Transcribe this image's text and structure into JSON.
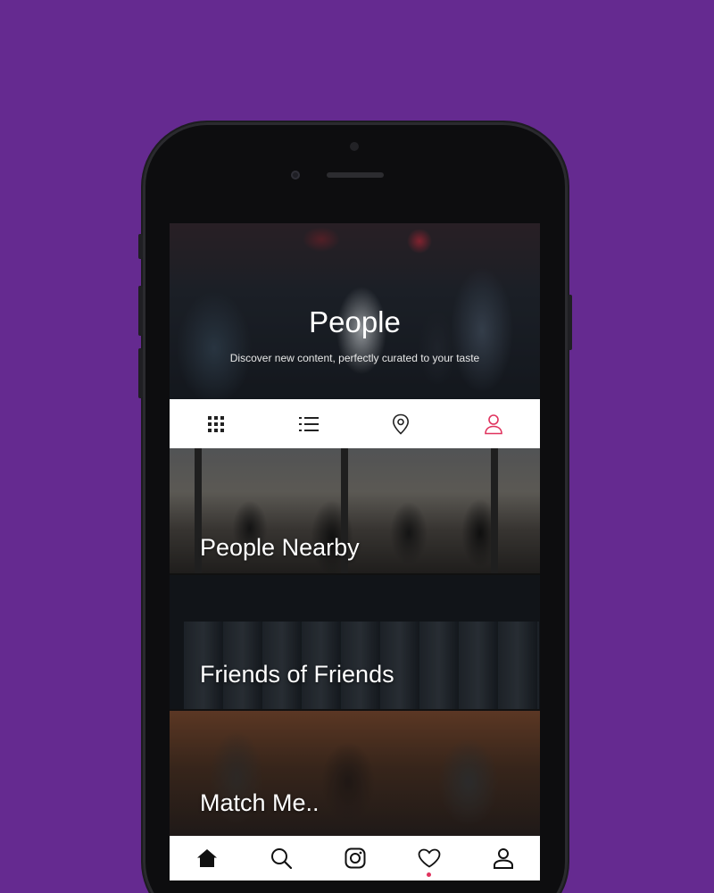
{
  "hero": {
    "title": "People",
    "subtitle": "Discover new content, perfectly curated to your taste"
  },
  "tabs": [
    {
      "icon": "grid-icon",
      "active": false
    },
    {
      "icon": "list-icon",
      "active": false
    },
    {
      "icon": "location-pin-icon",
      "active": false
    },
    {
      "icon": "person-icon",
      "active": true
    }
  ],
  "categories": [
    {
      "label": "People Nearby"
    },
    {
      "label": "Friends of Friends"
    },
    {
      "label": "Match Me.."
    }
  ],
  "bottom_nav": [
    {
      "icon": "home-icon",
      "active": false
    },
    {
      "icon": "search-icon",
      "active": false
    },
    {
      "icon": "instagram-icon",
      "active": false
    },
    {
      "icon": "heart-icon",
      "active": true
    },
    {
      "icon": "profile-icon",
      "active": false
    }
  ],
  "colors": {
    "background": "#652a90",
    "accent": "#e0335e",
    "icon": "#222222"
  }
}
